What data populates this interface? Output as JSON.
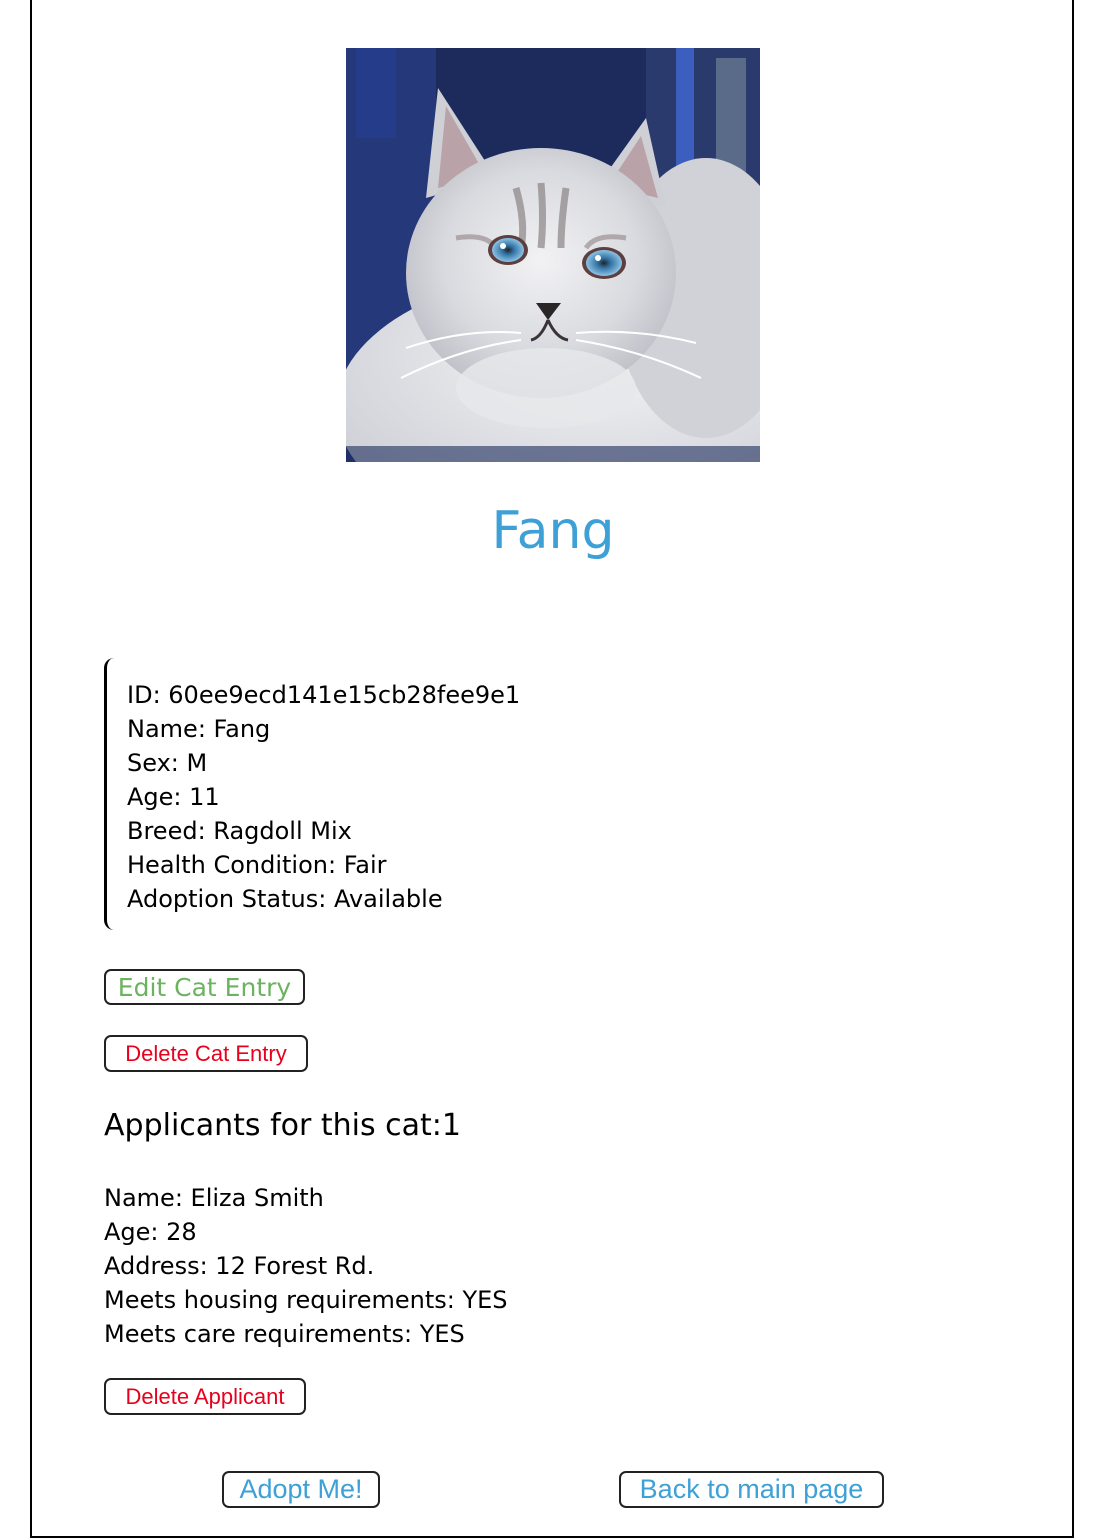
{
  "photo": {
    "alt": "Fang",
    "icon": "cat-photo"
  },
  "cat": {
    "title": "Fang",
    "fields": [
      {
        "label": "ID",
        "value": "60ee9ecd141e15cb28fee9e1"
      },
      {
        "label": "Name",
        "value": "Fang"
      },
      {
        "label": "Sex",
        "value": "M"
      },
      {
        "label": "Age",
        "value": "11"
      },
      {
        "label": "Breed",
        "value": "Ragdoll Mix"
      },
      {
        "label": "Health Condition",
        "value": "Fair"
      },
      {
        "label": "Adoption Status",
        "value": "Available"
      }
    ]
  },
  "actions": {
    "edit_label": "Edit Cat Entry",
    "delete_label": "Delete Cat Entry"
  },
  "applicants": {
    "heading": "Applicants for this cat:1",
    "list": [
      {
        "fields": [
          {
            "label": "Name",
            "value": "Eliza Smith"
          },
          {
            "label": "Age",
            "value": "28"
          },
          {
            "label": "Address",
            "value": "12 Forest Rd."
          },
          {
            "label": "Meets housing requirements",
            "value": "YES"
          },
          {
            "label": "Meets care requirements",
            "value": "YES"
          }
        ],
        "delete_label": "Delete Applicant"
      }
    ]
  },
  "footer": {
    "adopt_label": "Adopt Me!",
    "back_label": "Back to main page"
  },
  "colors": {
    "title": "#3da0d6",
    "edit": "#6bb35f",
    "delete": "#e8001c",
    "link": "#3da0d6"
  }
}
